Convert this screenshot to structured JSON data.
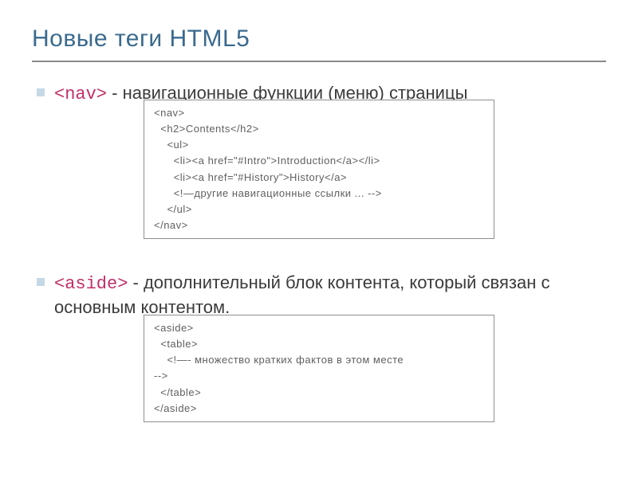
{
  "slide": {
    "title": "Новые теги HTML5"
  },
  "item1": {
    "tag": "<nav>",
    "desc": " - навигационные функции (меню) страницы"
  },
  "item2": {
    "tag": "<aside>",
    "desc": " - дополнительный блок контента, который связан с основным контентом."
  },
  "code1": {
    "l1": "<nav>",
    "l2": "  <h2>Contents</h2>",
    "l3": "    <ul>",
    "l4": "      <li><a href=\"#Intro\">Introduction</a></li>",
    "l5": "      <li><a href=\"#History\">History</a>",
    "l6": "      <!—другие навигационные ссылки ... -->",
    "l7": "    </ul>",
    "l8": "</nav>"
  },
  "code2": {
    "l1": "<aside>",
    "l2": "  <table>",
    "l3": "    <!—- множество кратких фактов в этом месте",
    "l4": "-->",
    "l5": "  </table>",
    "l6": "</aside>"
  }
}
